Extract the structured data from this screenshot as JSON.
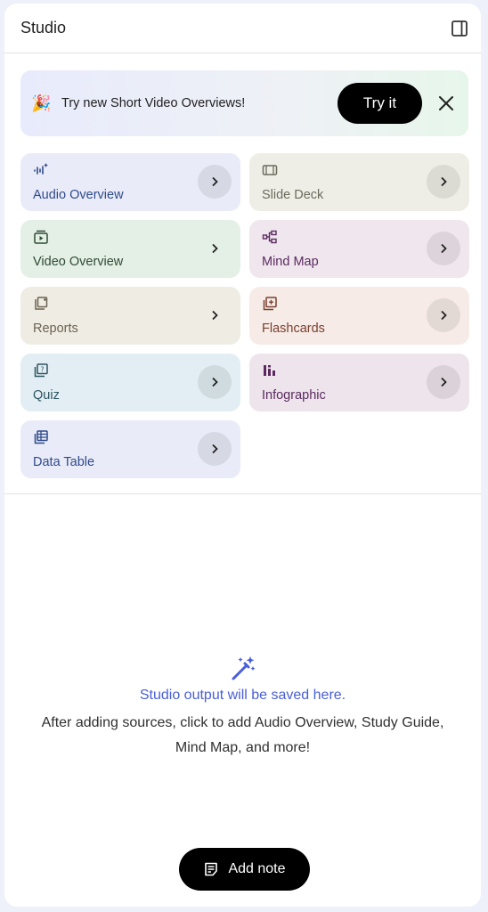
{
  "header": {
    "title": "Studio",
    "toggle_icon": "panel-toggle-icon"
  },
  "promo": {
    "emoji": "🎉",
    "text": "Try new Short Video Overviews!",
    "button_label": "Try it",
    "close_icon": "close-icon"
  },
  "cards": [
    {
      "label": "Audio Overview",
      "icon": "audio-waveform-icon",
      "bg": "#e9ebf8",
      "fg": "#2f4a8a",
      "arrow_style": "circle"
    },
    {
      "label": "Slide Deck",
      "icon": "slides-icon",
      "bg": "#eeeee6",
      "fg": "#6b6b5e",
      "arrow_style": "circle"
    },
    {
      "label": "Video Overview",
      "icon": "video-icon",
      "bg": "#e4efe6",
      "fg": "#2f4b35",
      "arrow_style": "plain"
    },
    {
      "label": "Mind Map",
      "icon": "mind-map-icon",
      "bg": "#f0e6ee",
      "fg": "#5b2b60",
      "arrow_style": "circle"
    },
    {
      "label": "Reports",
      "icon": "reports-icon",
      "bg": "#efece4",
      "fg": "#6c6350",
      "arrow_style": "plain"
    },
    {
      "label": "Flashcards",
      "icon": "flashcards-icon",
      "bg": "#f6ebe7",
      "fg": "#7a3f2e",
      "arrow_style": "circle"
    },
    {
      "label": "Quiz",
      "icon": "quiz-icon",
      "bg": "#e2eef3",
      "fg": "#2e5561",
      "arrow_style": "circle"
    },
    {
      "label": "Infographic",
      "icon": "infographic-icon",
      "bg": "#eee4ec",
      "fg": "#5b2b60",
      "arrow_style": "circle"
    },
    {
      "label": "Data Table",
      "icon": "table-icon",
      "bg": "#e9ebf8",
      "fg": "#2f4a8a",
      "arrow_style": "circle"
    }
  ],
  "empty_state": {
    "icon": "magic-wand-icon",
    "headline": "Studio output will be saved here.",
    "description": "After adding sources, click to add Audio Overview, Study Guide, Mind Map, and more!"
  },
  "add_note": {
    "label": "Add note",
    "icon": "note-icon"
  }
}
